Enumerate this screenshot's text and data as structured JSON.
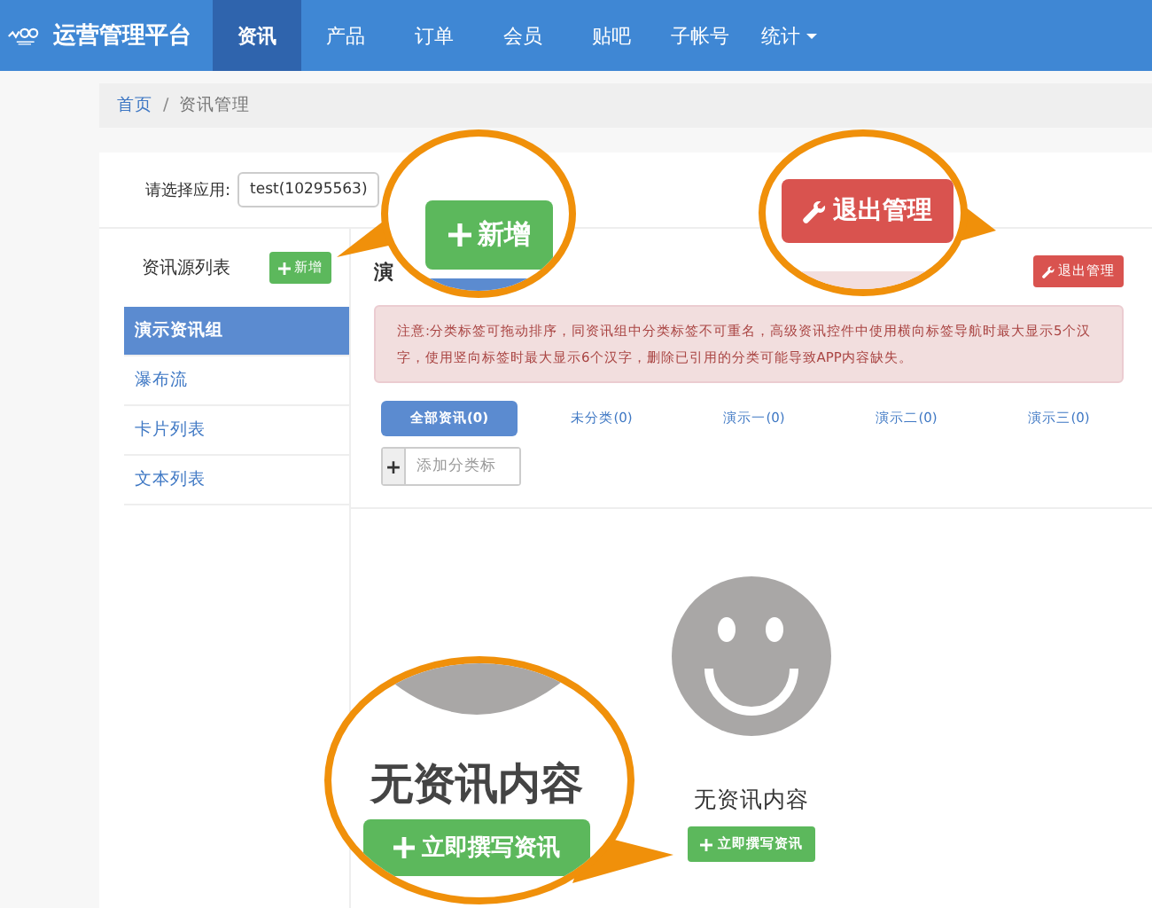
{
  "navbar": {
    "brand": "运营管理平台",
    "items": [
      {
        "label": "资讯",
        "selected": true,
        "dropdown": false
      },
      {
        "label": "产品",
        "selected": false,
        "dropdown": false
      },
      {
        "label": "订单",
        "selected": false,
        "dropdown": false
      },
      {
        "label": "会员",
        "selected": false,
        "dropdown": false
      },
      {
        "label": "贴吧",
        "selected": false,
        "dropdown": false
      },
      {
        "label": "子帐号",
        "selected": false,
        "dropdown": false
      },
      {
        "label": "统计",
        "selected": false,
        "dropdown": true
      }
    ]
  },
  "breadcrumb": {
    "separator": "/",
    "items": [
      {
        "label": "首页",
        "kind": "link"
      },
      {
        "label": "资讯管理",
        "kind": "current"
      }
    ]
  },
  "app_select": {
    "label": "请选择应用:",
    "value": "test(10295563)"
  },
  "sidebar": {
    "title": "资讯源列表",
    "add_button": "新增",
    "items": [
      {
        "label": "演示资讯组",
        "selected": true
      },
      {
        "label": "瀑布流",
        "selected": false
      },
      {
        "label": "卡片列表",
        "selected": false
      },
      {
        "label": "文本列表",
        "selected": false
      }
    ]
  },
  "content": {
    "heading": "演",
    "exit_button": "退出管理",
    "notice": "注意:分类标签可拖动排序，同资讯组中分类标签不可重名，高级资讯控件中使用横向标签导航时最大显示5个汉字，使用竖向标签时最大显示6个汉字，删除已引用的分类可能导致APP内容缺失。",
    "tabs": [
      {
        "label": "全部资讯(0)",
        "selected": true
      },
      {
        "label": "未分类(0)",
        "selected": false
      },
      {
        "label": "演示一(0)",
        "selected": false
      },
      {
        "label": "演示二(0)",
        "selected": false
      },
      {
        "label": "演示三(0)",
        "selected": false
      }
    ],
    "add_category": {
      "addon": "+",
      "placeholder": "添加分类标"
    }
  },
  "empty_state": {
    "message": "无资讯内容",
    "button": "立即撰写资讯"
  },
  "callouts": [
    {
      "kind": "add",
      "button": "新增"
    },
    {
      "kind": "exit",
      "button": "退出管理"
    },
    {
      "kind": "empty",
      "message": "无资讯内容",
      "button": "立即撰写资讯"
    }
  ]
}
